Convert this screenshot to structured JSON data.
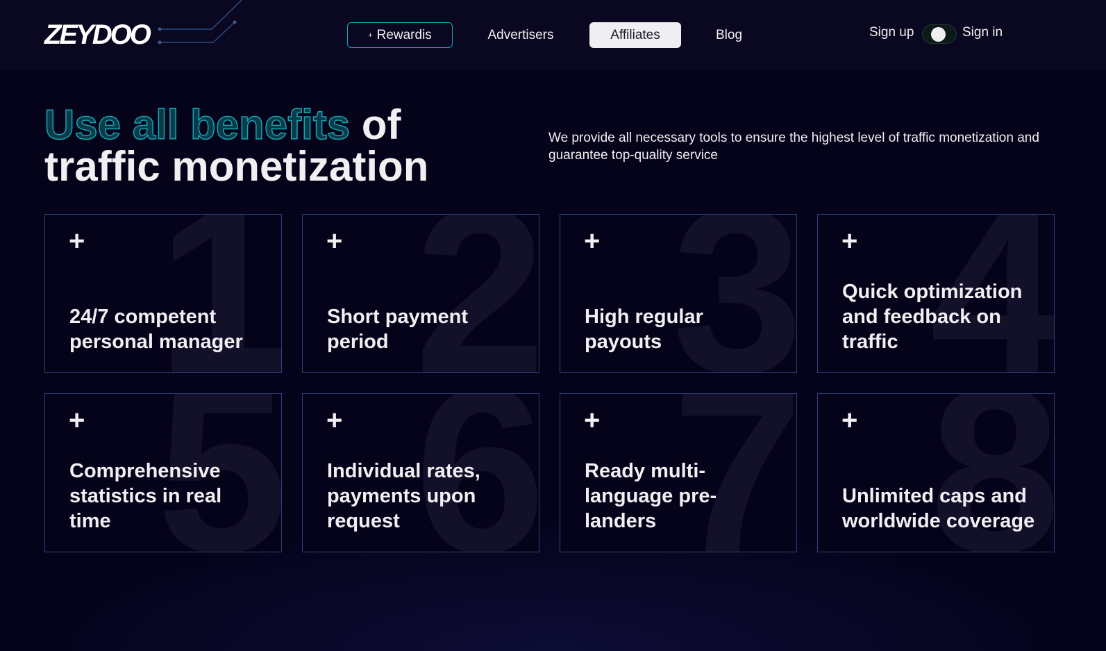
{
  "header": {
    "logo": "ZEYDOO",
    "nav": [
      {
        "label": "Rewardis",
        "prefix": "+"
      },
      {
        "label": "Advertisers"
      },
      {
        "label": "Affiliates"
      },
      {
        "label": "Blog"
      }
    ],
    "sign_up": "Sign up",
    "sign_in": "Sign in"
  },
  "hero": {
    "title_outline": "Use all benefits",
    "title_rest_1": " of",
    "title_line2": "traffic monetization",
    "description": "We provide all necessary tools to ensure the highest level of traffic monetization and guarantee top-quality service"
  },
  "colors": {
    "accent": "#13a6b5",
    "background": "#05031a",
    "card_border": "#2e3f78"
  },
  "cards": [
    {
      "num": "1",
      "text": "24/7 competent personal manager"
    },
    {
      "num": "2",
      "text": "Short payment period"
    },
    {
      "num": "3",
      "text": "High regular payouts"
    },
    {
      "num": "4",
      "text": "Quick optimization and feedback on traffic"
    },
    {
      "num": "5",
      "text": "Comprehensive statistics in real time"
    },
    {
      "num": "6",
      "text": "Individual rates, payments upon request"
    },
    {
      "num": "7",
      "text": "Ready multi-language pre-landers"
    },
    {
      "num": "8",
      "text": "Unlimited caps and worldwide coverage"
    }
  ]
}
